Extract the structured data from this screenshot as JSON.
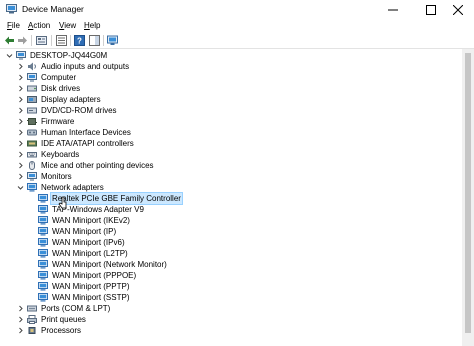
{
  "window": {
    "title": "Device Manager"
  },
  "menu": [
    {
      "label": "File",
      "underline": "F",
      "rest": "ile"
    },
    {
      "label": "Action",
      "underline": "A",
      "rest": "ction"
    },
    {
      "label": "View",
      "underline": "V",
      "rest": "iew"
    },
    {
      "label": "Help",
      "underline": "H",
      "rest": "elp"
    }
  ],
  "tree": {
    "root": "DESKTOP-JQ44G0M",
    "categories": [
      {
        "label": "Audio inputs and outputs",
        "icon": "speaker-icon"
      },
      {
        "label": "Computer",
        "icon": "computer-icon"
      },
      {
        "label": "Disk drives",
        "icon": "disk-drive-icon"
      },
      {
        "label": "Display adapters",
        "icon": "display-adapter-icon"
      },
      {
        "label": "DVD/CD-ROM drives",
        "icon": "dvd-drive-icon"
      },
      {
        "label": "Firmware",
        "icon": "firmware-icon"
      },
      {
        "label": "Human Interface Devices",
        "icon": "hid-icon"
      },
      {
        "label": "IDE ATA/ATAPI controllers",
        "icon": "ide-controller-icon"
      },
      {
        "label": "Keyboards",
        "icon": "keyboard-icon"
      },
      {
        "label": "Mice and other pointing devices",
        "icon": "mouse-icon"
      },
      {
        "label": "Monitors",
        "icon": "monitor-icon"
      },
      {
        "label": "Network adapters",
        "icon": "network-adapter-icon",
        "expanded": true
      }
    ],
    "network_adapters": [
      "Realtek PCIe GBE Family Controller",
      "TAP-Windows Adapter V9",
      "WAN Miniport (IKEv2)",
      "WAN Miniport (IP)",
      "WAN Miniport (IPv6)",
      "WAN Miniport (L2TP)",
      "WAN Miniport (Network Monitor)",
      "WAN Miniport (PPPOE)",
      "WAN Miniport (PPTP)",
      "WAN Miniport (SSTP)"
    ],
    "after": [
      {
        "label": "Ports (COM & LPT)",
        "icon": "port-icon"
      },
      {
        "label": "Print queues",
        "icon": "printer-icon"
      },
      {
        "label": "Processors",
        "icon": "processor-icon"
      }
    ],
    "selected": "Realtek PCIe GBE Family Controller"
  },
  "colors": {
    "selection": "#cce8ff",
    "selection_border": "#99d1ff",
    "net_icon": "#3a8fd8"
  }
}
